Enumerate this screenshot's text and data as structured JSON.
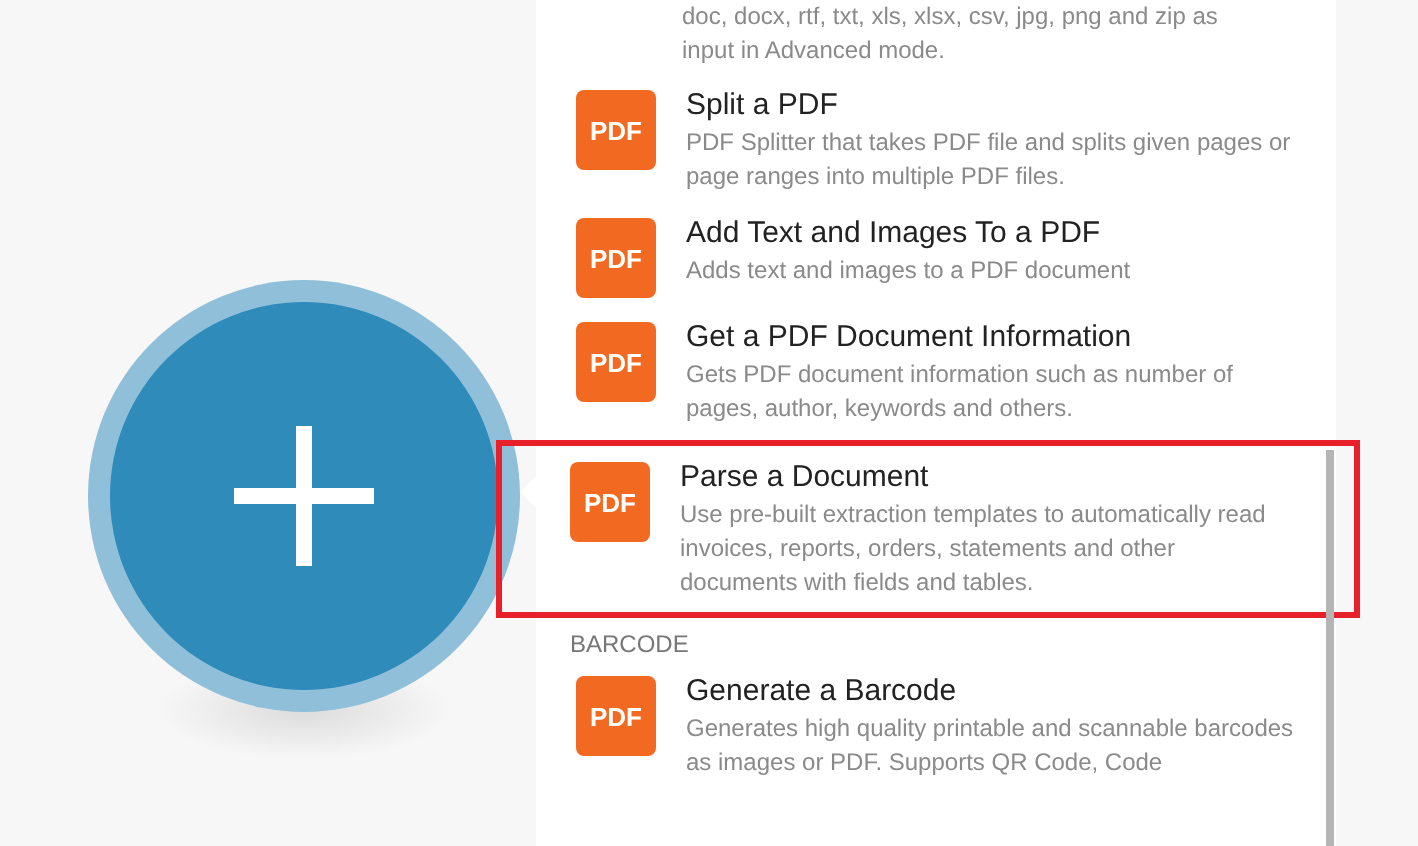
{
  "list": [
    {
      "kind": "continuation",
      "lines": [
        "doc, docx, rtf, txt, xls, xlsx, csv, jpg, png and zip as",
        "input in Advanced mode."
      ]
    },
    {
      "kind": "module",
      "badge": "PDF",
      "title": "Split a PDF",
      "description": "PDF Splitter that takes PDF file and splits given pages or page ranges into multiple PDF files.",
      "highlighted": false
    },
    {
      "kind": "module",
      "badge": "PDF",
      "title": "Add Text and Images To a PDF",
      "description": "Adds text and images to a PDF document",
      "highlighted": false
    },
    {
      "kind": "module",
      "badge": "PDF",
      "title": "Get a PDF Document Information",
      "description": "Gets PDF document information such as number of pages, author, keywords and others.",
      "highlighted": false
    },
    {
      "kind": "module",
      "badge": "PDF",
      "title": "Parse a Document",
      "description": "Use pre-built extraction templates to automatically read invoices, reports, orders, statements and other documents with fields and tables.",
      "highlighted": true
    },
    {
      "kind": "heading",
      "text": "BARCODE"
    },
    {
      "kind": "module",
      "badge": "PDF",
      "title": "Generate a Barcode",
      "description": "Generates high quality printable and scannable barcodes as images or PDF. Supports QR Code, Code",
      "highlighted": false
    }
  ]
}
